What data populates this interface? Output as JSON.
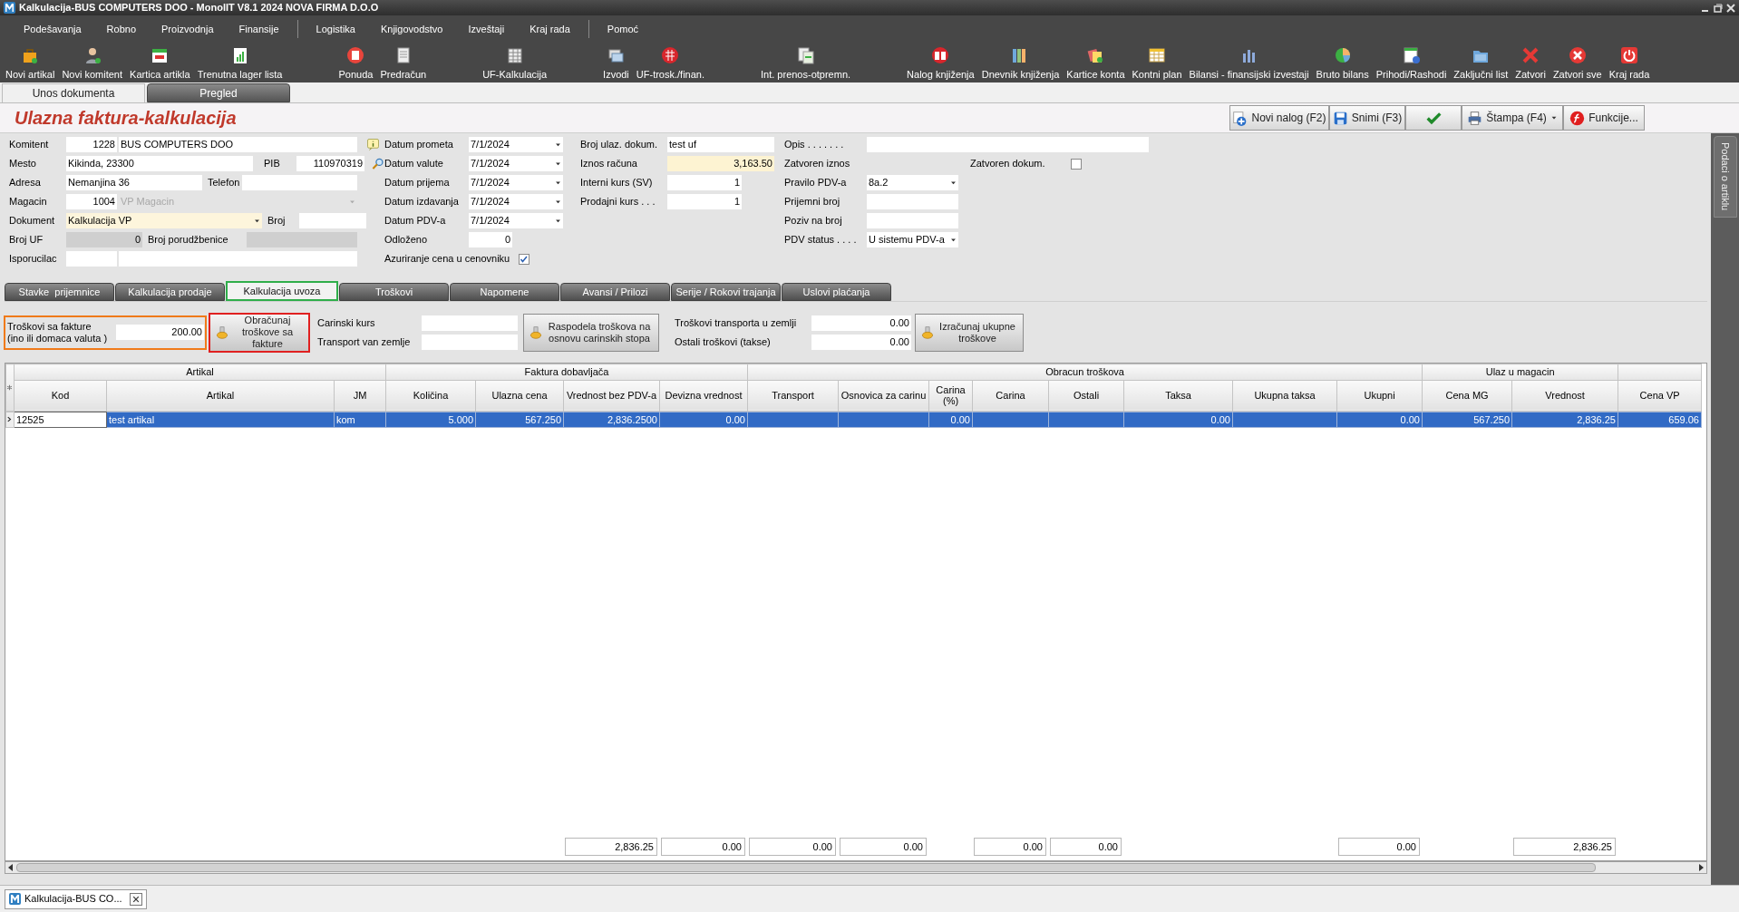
{
  "window": {
    "title": "Kalkulacija-BUS COMPUTERS DOO - MonolIT V8.1 2024 NOVA FIRMA D.O.O"
  },
  "menu": [
    [
      "Podešavanja",
      "Robno",
      "Proizvodnja",
      "Finansije"
    ],
    [
      "Logistika",
      "Knjigovodstvo",
      "Izveštaji",
      "Kraj rada"
    ],
    [
      "Pomoć"
    ]
  ],
  "toolbar": [
    [
      "Novi artikal",
      "Novi komitent",
      "Kartica artikla",
      "Trenutna lager lista"
    ],
    [
      "Ponuda",
      "Predračun"
    ],
    [
      "UF-Kalkulacija"
    ],
    [
      "Izvodi",
      "UF-trosk./finan."
    ],
    [
      "Int. prenos-otpremn."
    ],
    [
      "Nalog knjiženja",
      "Dnevnik knjiženja",
      "Kartice konta",
      "Kontni plan",
      "Bilansi - finansijski izvestaji",
      "Bruto bilans",
      "Prihodi/Rashodi",
      "Zaključni list",
      "Zatvori",
      "Zatvori sve",
      "Kraj rada"
    ]
  ],
  "doc_tabs": [
    {
      "label": "Unos dokumenta",
      "selected": true
    },
    {
      "label": "Pregled",
      "selected": false
    }
  ],
  "form_title": "Ulazna faktura-kalkulacija",
  "header_buttons": [
    {
      "kind": "new",
      "label": "Novi nalog (F2)"
    },
    {
      "kind": "save",
      "label": "Snimi (F3)"
    },
    {
      "kind": "confirm"
    },
    {
      "kind": "print",
      "label": "Štampa (F4)"
    },
    {
      "kind": "functions",
      "label": "Funkcije..."
    }
  ],
  "form": {
    "komitent": {
      "label": "Komitent",
      "code": "1228",
      "value": "BUS COMPUTERS DOO"
    },
    "mesto": {
      "label": "Mesto",
      "value": "Kikinda, 23300"
    },
    "pib": {
      "label": "PIB",
      "value": "110970319"
    },
    "adresa": {
      "label": "Adresa",
      "value": "Nemanjina 36"
    },
    "telefon": {
      "label": "Telefon"
    },
    "magacin": {
      "label": "Magacin",
      "code": "1004",
      "value": "VP Magacin",
      "disabled": true
    },
    "dokument": {
      "label": "Dokument",
      "value": "Kalkulacija VP"
    },
    "broj": {
      "label": "Broj"
    },
    "broj_uf": {
      "label": "Broj UF",
      "value": "0"
    },
    "broj_porudzbenice": {
      "label": "Broj porudžbenice"
    },
    "isporucilac": {
      "label": "Isporucilac"
    }
  },
  "dates": [
    {
      "label": "Datum prometa",
      "value": "7/1/2024"
    },
    {
      "label": "Datum valute",
      "value": "7/1/2024"
    },
    {
      "label": "Datum prijema",
      "value": "7/1/2024"
    },
    {
      "label": "Datum izdavanja",
      "value": "7/1/2024"
    },
    {
      "label": "Datum PDV-a",
      "value": "7/1/2024"
    }
  ],
  "odlozeno": {
    "label": "Odloženo",
    "value": "0"
  },
  "azuriranje": {
    "label": "Azuriranje cena u cenovniku",
    "checked": true
  },
  "doc_info": [
    {
      "kind": "text",
      "label": "Broj ulaz. dokum.",
      "value": "test uf"
    },
    {
      "kind": "amount",
      "label": "Iznos računa",
      "value": "3,163.50"
    },
    {
      "kind": "number",
      "label": "Interni kurs (SV)",
      "value": "1"
    },
    {
      "kind": "number",
      "label": "Prodajni kurs . . .",
      "value": "1"
    }
  ],
  "extra": [
    {
      "kind": "wide",
      "label": "Opis . . . . . . ."
    },
    {
      "kind": "label",
      "label": "Zatvoren iznos"
    },
    {
      "kind": "dropdown",
      "label": "Pravilo PDV-a",
      "value": "8a.2"
    },
    {
      "kind": "text",
      "label": "Prijemni broj"
    },
    {
      "kind": "text",
      "label": "Poziv na broj"
    },
    {
      "kind": "dropdown",
      "label": "PDV status . . . .",
      "value": "U sistemu PDV-a"
    }
  ],
  "zatvoren_dokum": {
    "label": "Zatvoren dokum.",
    "checked": false
  },
  "sub_tabs": [
    {
      "label": "Stavke  prijemnice",
      "selected": false
    },
    {
      "label": "Kalkulacija prodaje",
      "selected": false
    },
    {
      "label": "Kalkulacija uvoza",
      "selected": true
    },
    {
      "label": "Troškovi",
      "selected": false
    },
    {
      "label": "Napomene",
      "selected": false
    },
    {
      "label": "Avansi / Prilozi",
      "selected": false
    },
    {
      "label": "Serije / Rokovi trajanja",
      "selected": false
    },
    {
      "label": "Uslovi plaćanja",
      "selected": false
    }
  ],
  "costs": {
    "invoice_costs": {
      "label": [
        "Troškovi sa fakture",
        "(ino ili domaca valuta )"
      ],
      "value": "200.00"
    },
    "calc_button": "Obračunaj troškove sa fakture",
    "carinski_kurs": {
      "label": "Carinski kurs"
    },
    "transport_van": {
      "label": "Transport van zemlje"
    },
    "distribute_button": "Raspodela troškova na osnovu carinskih stopa",
    "transport_u": {
      "label": "Troškovi transporta u zemlji",
      "value": "0.00"
    },
    "ostali": {
      "label": "Ostali troškovi (takse)",
      "value": "0.00"
    },
    "total_button": "Izračunaj ukupne troškove"
  },
  "side_tab": "Podaci o artiklu",
  "table": {
    "groups": [
      {
        "label": "Artikal",
        "columns": [
          {
            "label": "Kod"
          },
          {
            "label": "Artikal"
          },
          {
            "label": "JM"
          }
        ]
      },
      {
        "label": "Faktura dobavljača",
        "columns": [
          {
            "label": "Količina"
          },
          {
            "label": "Ulazna cena"
          },
          {
            "label": "Vrednost bez PDV-a",
            "total": "2,836.25"
          },
          {
            "label": "Devizna vrednost",
            "total": "0.00"
          }
        ]
      },
      {
        "label": "Obracun troškova",
        "columns": [
          {
            "label": "Transport",
            "total": "0.00"
          },
          {
            "label": "Osnovica za carinu",
            "total": "0.00"
          },
          {
            "label": "Carina (%)"
          },
          {
            "label": "Carina",
            "total": "0.00"
          },
          {
            "label": "Ostali",
            "total": "0.00"
          },
          {
            "label": "Taksa"
          },
          {
            "label": "Ukupna taksa"
          },
          {
            "label": "Ukupni",
            "total": "0.00"
          }
        ]
      },
      {
        "label": "Ulaz u magacin",
        "columns": [
          {
            "label": "Cena MG"
          },
          {
            "label": "Vrednost",
            "total": "2,836.25"
          }
        ]
      },
      {
        "columns": [
          {
            "label": "Cena VP"
          }
        ]
      }
    ],
    "rows": [
      {
        "selected": true,
        "cells": [
          "12525",
          "test artikal",
          "kom",
          "5.000",
          "567.250",
          "2,836.2500",
          "0.00",
          null,
          null,
          "0.00",
          null,
          null,
          "0.00",
          null,
          "0.00",
          "567.250",
          "2,836.25",
          "659.06"
        ]
      }
    ]
  },
  "taskbar": [
    {
      "label": "Kalkulacija-BUS CO...",
      "selected": true
    }
  ]
}
